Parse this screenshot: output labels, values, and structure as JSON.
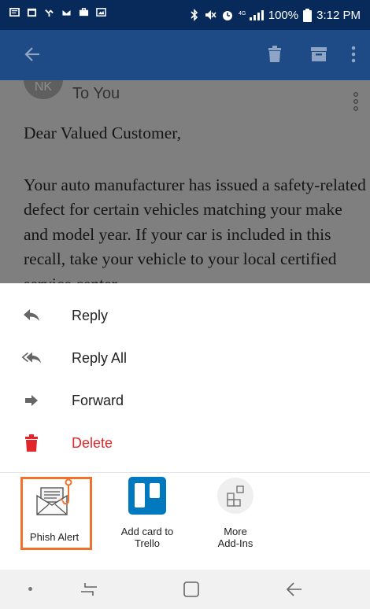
{
  "status_bar": {
    "battery": "100%",
    "time": "3:12 PM"
  },
  "app_bar": {
    "icons": [
      "back-arrow-icon",
      "trash-icon",
      "archive-icon",
      "more-vert-icon"
    ]
  },
  "email": {
    "avatar_initials": "NK",
    "to": "To You",
    "greeting": "Dear Valued Customer,",
    "body": "Your auto manufacturer has issued a safety-related defect for certain vehicles matching your make and model year. If your car is included in this recall, take your vehicle to your local certified service center"
  },
  "menu": {
    "items": [
      {
        "label": "Reply",
        "icon": "reply-icon"
      },
      {
        "label": "Reply All",
        "icon": "reply-all-icon"
      },
      {
        "label": "Forward",
        "icon": "forward-icon"
      },
      {
        "label": "Delete",
        "icon": "delete-icon"
      }
    ]
  },
  "addins": [
    {
      "label": "Phish Alert",
      "icon": "phish-alert-icon"
    },
    {
      "label_line1": "Add card to",
      "label_line2": "Trello",
      "icon": "trello-icon"
    },
    {
      "label_line1": "More",
      "label_line2": "Add-Ins",
      "icon": "more-addins-icon"
    }
  ],
  "colors": {
    "status_bar": "#072a5a",
    "app_bar": "#1e4b85",
    "delete_red": "#e0262a",
    "highlight_orange": "#f0712c",
    "trello_blue": "#0079bf"
  }
}
